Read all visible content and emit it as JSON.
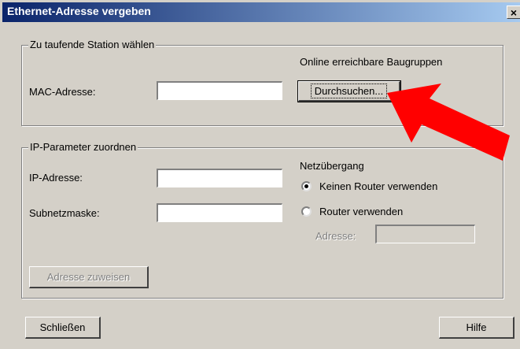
{
  "dialog": {
    "title": "Ethernet-Adresse vergeben",
    "close_glyph": "×"
  },
  "station_group": {
    "legend": "Zu taufende Station wählen",
    "online_label": "Online erreichbare Baugruppen",
    "mac_label": "MAC-Adresse:",
    "mac_value": "",
    "browse_button": "Durchsuchen..."
  },
  "ip_group": {
    "legend": "IP-Parameter zuordnen",
    "ip_label": "IP-Adresse:",
    "ip_value": "",
    "subnet_label": "Subnetzmaske:",
    "subnet_value": "",
    "gateway_label": "Netzübergang",
    "radio_no_router": "Keinen Router verwenden",
    "radio_no_router_selected": true,
    "radio_use_router": "Router verwenden",
    "router_address_label": "Adresse:",
    "router_address_value": "",
    "assign_button": "Adresse zuweisen"
  },
  "footer": {
    "close_button": "Schließen",
    "help_button": "Hilfe"
  },
  "annotation": {
    "arrow_color": "#ff0000"
  }
}
